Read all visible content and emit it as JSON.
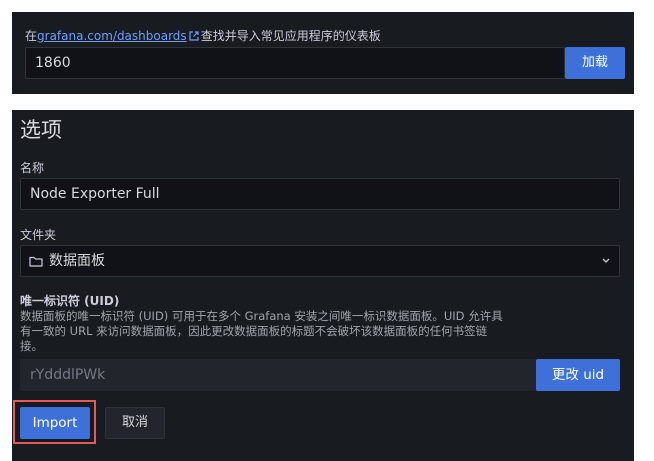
{
  "import_source": {
    "hint_prefix": "在",
    "hint_link": "grafana.com/dashboards",
    "hint_suffix": "查找并导入常见应用程序的仪表板",
    "input_value": "1860",
    "load_label": "加载"
  },
  "options": {
    "title": "选项",
    "name_label": "名称",
    "name_value": "Node Exporter Full",
    "folder_label": "文件夹",
    "folder_value": "数据面板",
    "uid_label": "唯一标识符 (UID)",
    "uid_description": "数据面板的唯一标识符 (UID) 可用于在多个 Grafana 安装之间唯一标识数据面板。UID 允许具有一致的 URL 来访问数据面板，因此更改数据面板的标题不会破坏该数据面板的任何书签链接。",
    "uid_value": "rYdddlPWk",
    "change_uid_label": "更改 uid",
    "import_label": "Import",
    "cancel_label": "取消"
  },
  "colors": {
    "panel_bg": "#181b1f",
    "primary": "#3d71d9",
    "link": "#6e9fff",
    "highlight": "#e85a5a"
  },
  "icons": [
    "external-link-icon",
    "folder-icon",
    "chevron-down-icon"
  ]
}
